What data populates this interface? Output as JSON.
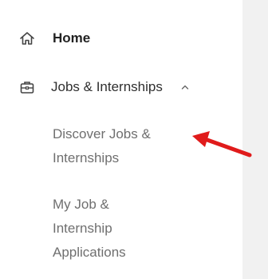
{
  "nav": {
    "home": {
      "label": "Home",
      "icon": "home-icon"
    },
    "jobs": {
      "label": "Jobs & Internships",
      "icon": "briefcase-icon",
      "expanded": true
    },
    "sub_items": {
      "discover": {
        "line1": "Discover Jobs &",
        "line2": "Internships"
      },
      "applications": {
        "line1": "My Job &",
        "line2": "Internship",
        "line3": "Applications"
      }
    }
  },
  "colors": {
    "annotation_arrow": "#e01b1b",
    "text_primary": "#222222",
    "text_secondary": "#6f6f6f",
    "edge": "#f1f1f1"
  }
}
